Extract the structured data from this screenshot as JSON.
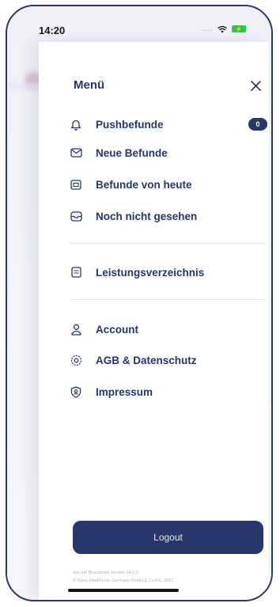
{
  "status_bar": {
    "time": "14:20",
    "signal": "....",
    "battery_icon": "battery-charging-icon",
    "wifi_icon": "wifi-icon"
  },
  "menu": {
    "title": "Menü",
    "close_icon": "close-icon",
    "items_group1": [
      {
        "label": "Pushbefunde",
        "icon": "bell-icon",
        "badge": "0"
      },
      {
        "label": "Neue Befunde",
        "icon": "envelope-icon"
      },
      {
        "label": "Befunde von heute",
        "icon": "calendar-icon"
      },
      {
        "label": "Noch nicht gesehen",
        "icon": "inbox-icon"
      }
    ],
    "items_group2": [
      {
        "label": "Leistungsverzeichnis",
        "icon": "document-icon"
      }
    ],
    "items_group3": [
      {
        "label": "Account",
        "icon": "user-icon"
      },
      {
        "label": "AGB & Datenschutz",
        "icon": "settings-badge-icon"
      },
      {
        "label": "Impressum",
        "icon": "shield-user-icon"
      }
    ],
    "logout_label": "Logout",
    "footer_version": "doc.net Bioscientia Version 24.3.0",
    "footer_copyright": "© Sonic Healthcare Germany GmbH & Co.KG, 2021"
  },
  "colors": {
    "primary": "#283669",
    "battery": "#33c24d",
    "divider": "#e2e4ec"
  }
}
